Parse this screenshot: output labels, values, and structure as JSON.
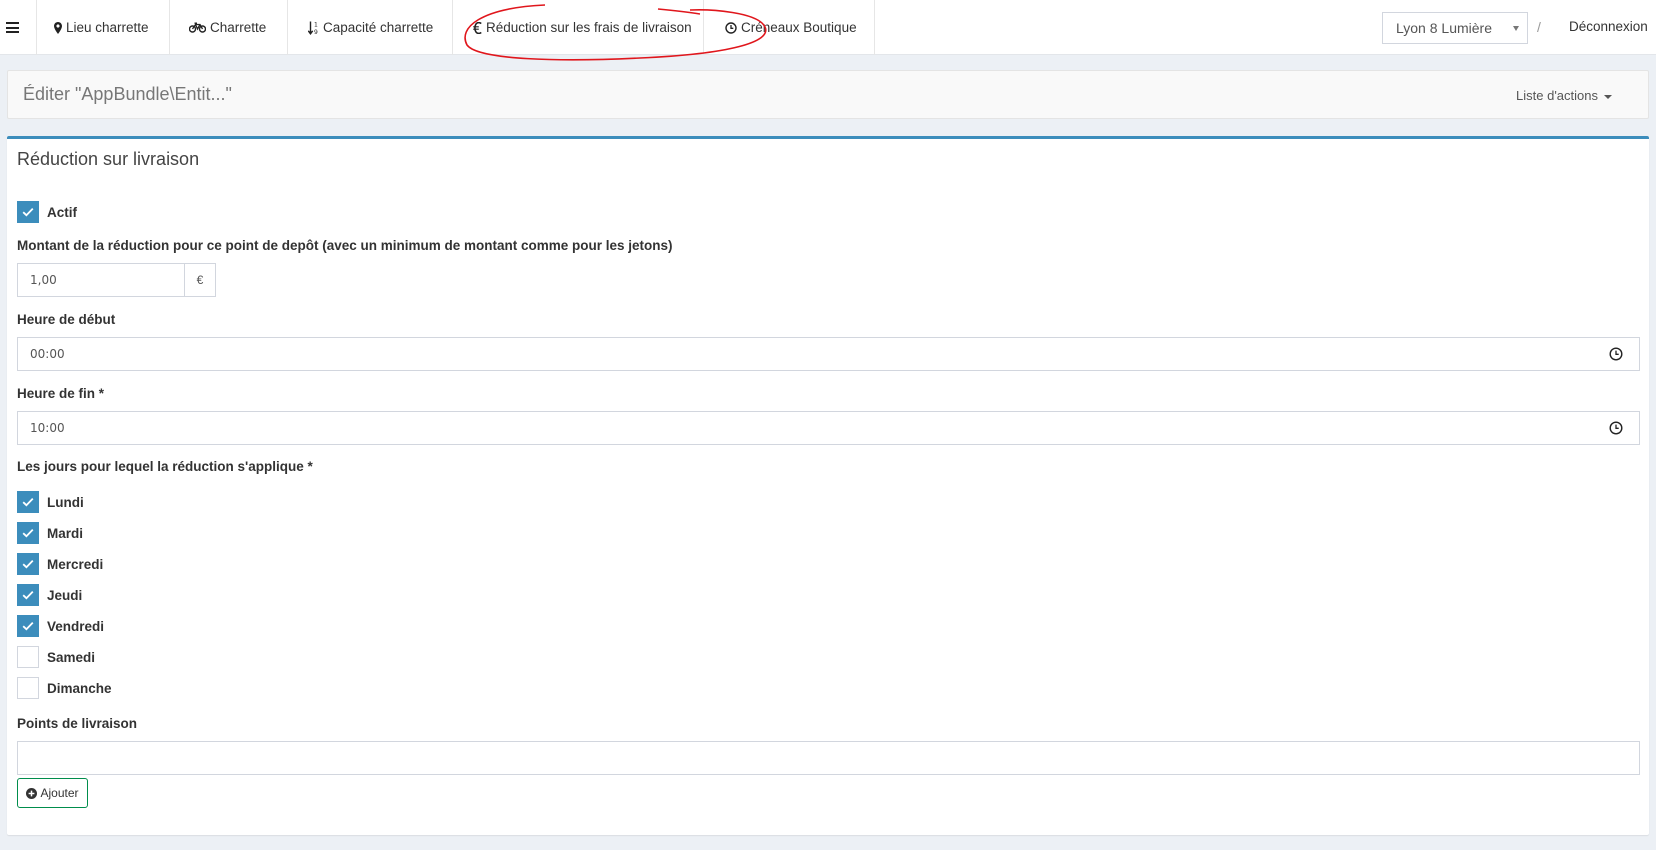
{
  "navbar": {
    "items": [
      {
        "label": "Lieu charrette",
        "icon": "map-marker-icon"
      },
      {
        "label": "Charrette",
        "icon": "bicycle-icon"
      },
      {
        "label": "Capacité charrette",
        "icon": "sort-numeric-icon"
      },
      {
        "label": "Réduction sur les frais de livraison",
        "icon": "euro-icon"
      },
      {
        "label": "Créneaux Boutique",
        "icon": "clock-icon"
      }
    ],
    "store_select": "Lyon 8 Lumière",
    "separator": "/",
    "logout": "Déconnexion"
  },
  "page_header": {
    "title": "Éditer \"AppBundle\\Entit...\"",
    "actions_label": "Liste d'actions"
  },
  "form": {
    "box_title": "Réduction sur livraison",
    "active": {
      "label": "Actif",
      "checked": true
    },
    "amount": {
      "label": "Montant de la réduction pour ce point de depôt (avec un minimum de montant comme pour les jetons)",
      "value": "1,00",
      "currency": "€"
    },
    "start_time": {
      "label": "Heure de début",
      "value": "00:00"
    },
    "end_time": {
      "label": "Heure de fin *",
      "value": "10:00"
    },
    "days": {
      "label": "Les jours pour lequel la réduction s'applique *",
      "items": [
        {
          "label": "Lundi",
          "checked": true
        },
        {
          "label": "Mardi",
          "checked": true
        },
        {
          "label": "Mercredi",
          "checked": true
        },
        {
          "label": "Jeudi",
          "checked": true
        },
        {
          "label": "Vendredi",
          "checked": true
        },
        {
          "label": "Samedi",
          "checked": false
        },
        {
          "label": "Dimanche",
          "checked": false
        }
      ]
    },
    "delivery_points": {
      "label": "Points de livraison",
      "value": ""
    },
    "add_button": "Ajouter"
  },
  "colors": {
    "primary": "#3c8dbc",
    "success_border": "#008d4c",
    "annotation": "#e0161c",
    "background": "#ecf0f5"
  }
}
